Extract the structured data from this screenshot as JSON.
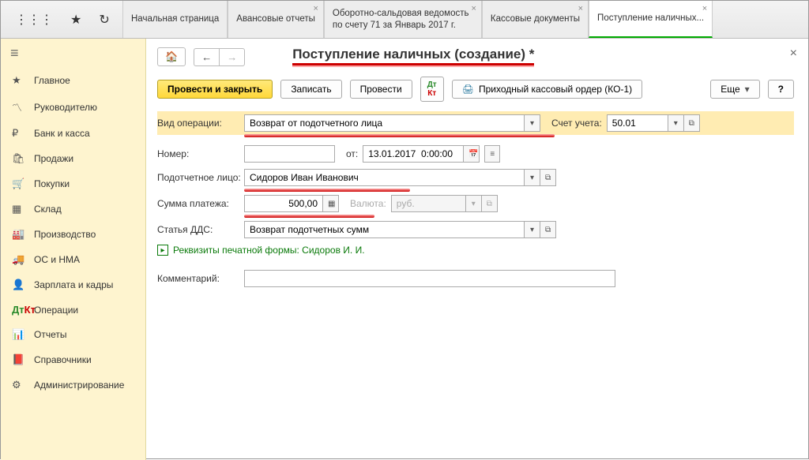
{
  "tabs": {
    "t0": "Начальная страница",
    "t1": "Авансовые отчеты",
    "t2": "Оборотно-сальдовая ведомость по счету 71 за Январь 2017 г.",
    "t3": "Кассовые документы",
    "t4": "Поступление наличных..."
  },
  "sidebar": {
    "s0": "Главное",
    "s1": "Руководителю",
    "s2": "Банк и касса",
    "s3": "Продажи",
    "s4": "Покупки",
    "s5": "Склад",
    "s6": "Производство",
    "s7": "ОС и НМА",
    "s8": "Зарплата и кадры",
    "s9": "Операции",
    "s10": "Отчеты",
    "s11": "Справочники",
    "s12": "Администрирование"
  },
  "page_title": "Поступление наличных (создание) *",
  "toolbar": {
    "post_close": "Провести и закрыть",
    "save": "Записать",
    "post": "Провести",
    "print_order": "Приходный кассовый ордер (КО-1)",
    "more": "Еще",
    "help": "?"
  },
  "form": {
    "op_type_label": "Вид операции:",
    "op_type_value": "Возврат от подотчетного лица",
    "account_label": "Счет учета:",
    "account_value": "50.01",
    "number_label": "Номер:",
    "number_value": "",
    "date_from_label": "от:",
    "date_value": "13.01.2017  0:00:00",
    "person_label": "Подотчетное лицо:",
    "person_value": "Сидоров Иван Иванович",
    "sum_label": "Сумма платежа:",
    "sum_value": "500,00",
    "currency_label": "Валюта:",
    "currency_value": "руб.",
    "dds_label": "Статья ДДС:",
    "dds_value": "Возврат подотчетных сумм",
    "expand_link": "Реквизиты печатной формы: Сидоров И. И.",
    "comment_label": "Комментарий:",
    "comment_value": ""
  }
}
